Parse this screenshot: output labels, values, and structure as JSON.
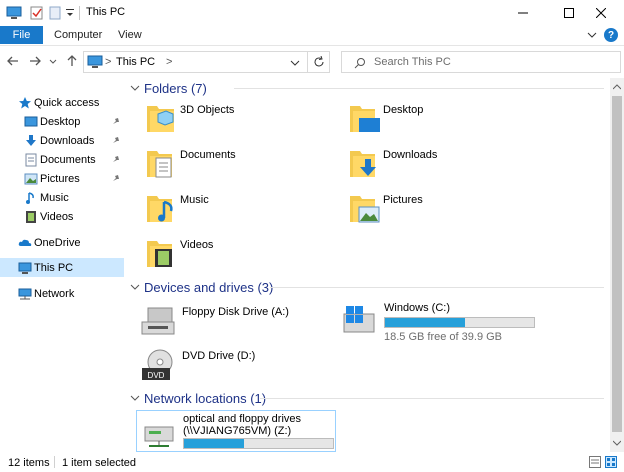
{
  "window": {
    "title": "This PC"
  },
  "ribbon": {
    "tabs": [
      "File",
      "Computer",
      "View"
    ],
    "help": "?"
  },
  "address": {
    "path": "This PC",
    "separator": ">",
    "search_placeholder": "Search This PC"
  },
  "nav": {
    "items": [
      {
        "label": "Quick access",
        "icon": "star-icon",
        "pinned": false
      },
      {
        "label": "Desktop",
        "icon": "desktop-icon",
        "pinned": true
      },
      {
        "label": "Downloads",
        "icon": "download-icon",
        "pinned": true
      },
      {
        "label": "Documents",
        "icon": "documents-icon",
        "pinned": true
      },
      {
        "label": "Pictures",
        "icon": "pictures-icon",
        "pinned": true
      },
      {
        "label": "Music",
        "icon": "music-icon",
        "pinned": false
      },
      {
        "label": "Videos",
        "icon": "videos-icon",
        "pinned": false
      },
      {
        "label": "OneDrive",
        "icon": "cloud-icon",
        "pinned": false
      },
      {
        "label": "This PC",
        "icon": "computer-icon",
        "pinned": false,
        "selected": true
      },
      {
        "label": "Network",
        "icon": "network-icon",
        "pinned": false
      }
    ]
  },
  "groups": {
    "folders": {
      "title": "Folders (7)",
      "items": [
        "3D Objects",
        "Desktop",
        "Documents",
        "Downloads",
        "Music",
        "Pictures",
        "Videos"
      ]
    },
    "devices": {
      "title": "Devices and drives (3)",
      "items": [
        {
          "label": "Floppy Disk Drive (A:)",
          "icon": "floppy-drive-icon"
        },
        {
          "label": "Windows (C:)",
          "icon": "windows-drive-icon",
          "used_fraction": 0.54,
          "free_text": "18.5 GB free of 39.9 GB"
        },
        {
          "label": "DVD Drive (D:)",
          "icon": "dvd-drive-icon",
          "badge": "DVD"
        }
      ]
    },
    "network": {
      "title": "Network locations (1)",
      "items": [
        {
          "label_line1": "optical and floppy drives",
          "label_line2": "(\\\\VJIANG765VM) (Z:)",
          "used_fraction": 0.4,
          "icon": "network-drive-icon"
        }
      ]
    }
  },
  "status": {
    "count": "12 items",
    "selected": "1 item selected"
  },
  "colors": {
    "accent": "#1979ca",
    "group_title": "#1e3287",
    "bar": "#26a0da",
    "selection": "#cce8ff"
  }
}
